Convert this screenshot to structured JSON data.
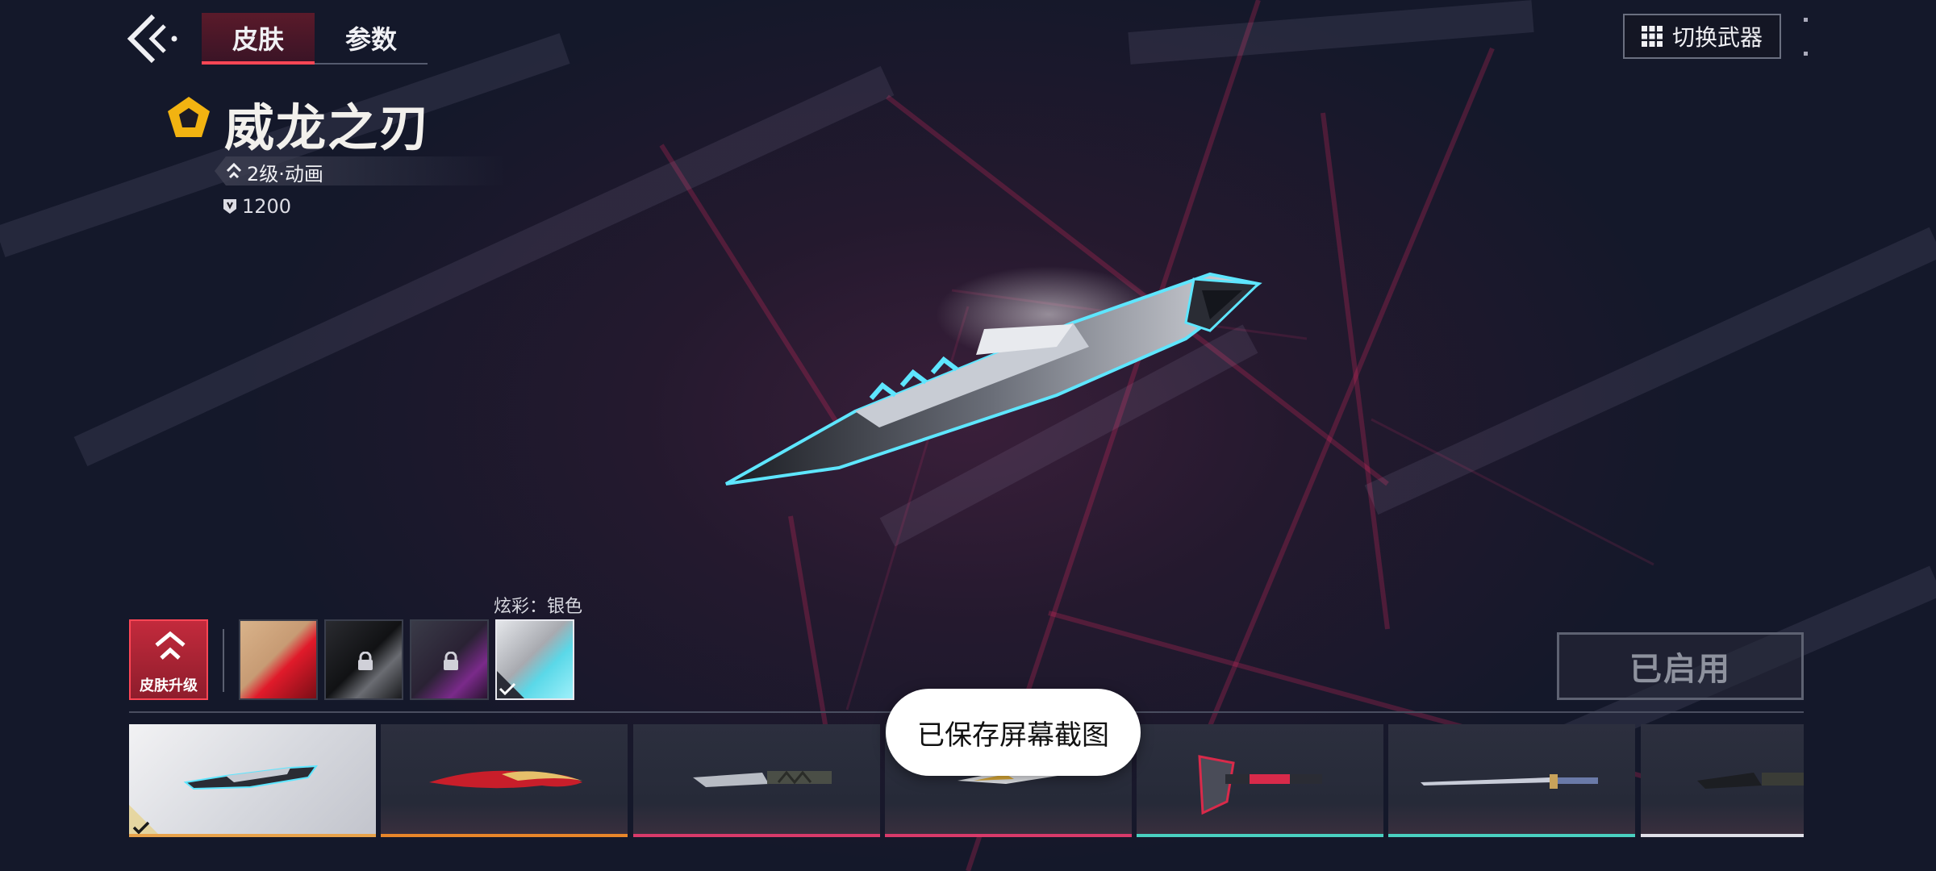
{
  "header": {
    "tabs": [
      {
        "label": "皮肤",
        "active": true
      },
      {
        "label": "参数",
        "active": false
      }
    ],
    "switch_weapon_label": "切换武器"
  },
  "skin": {
    "name": "威龙之刃",
    "level_label": "2级·动画",
    "price": "1200",
    "tier_color": "#f2b311",
    "tier_icon": "gold-pentagon-icon"
  },
  "chroma": {
    "label": "炫彩：银色",
    "upgrade_label": "皮肤升级",
    "options": [
      {
        "name": "gold-red",
        "locked": false,
        "selected": false
      },
      {
        "name": "black",
        "locked": true,
        "selected": false
      },
      {
        "name": "purple",
        "locked": true,
        "selected": false
      },
      {
        "name": "silver",
        "locked": false,
        "selected": true
      }
    ]
  },
  "equip_button_label": "已启用",
  "toast": "已保存屏幕截图",
  "skins_strip": [
    {
      "name": "silver-blade",
      "selected": true,
      "accent": "#e8a24a"
    },
    {
      "name": "gold-red-curved",
      "selected": false,
      "accent": "#e8862a"
    },
    {
      "name": "serrated-knife",
      "selected": false,
      "accent": "#d83a6a"
    },
    {
      "name": "gold-white-blade",
      "selected": false,
      "accent": "#d83a6a"
    },
    {
      "name": "red-axe",
      "selected": false,
      "accent": "#4ad0c0"
    },
    {
      "name": "sword",
      "selected": false,
      "accent": "#4ad0c0"
    },
    {
      "name": "black-knife",
      "selected": false,
      "accent": "#e0e0e8"
    }
  ],
  "colors": {
    "accent_red": "#ff4655",
    "neon_cyan": "#5ee6ff"
  }
}
